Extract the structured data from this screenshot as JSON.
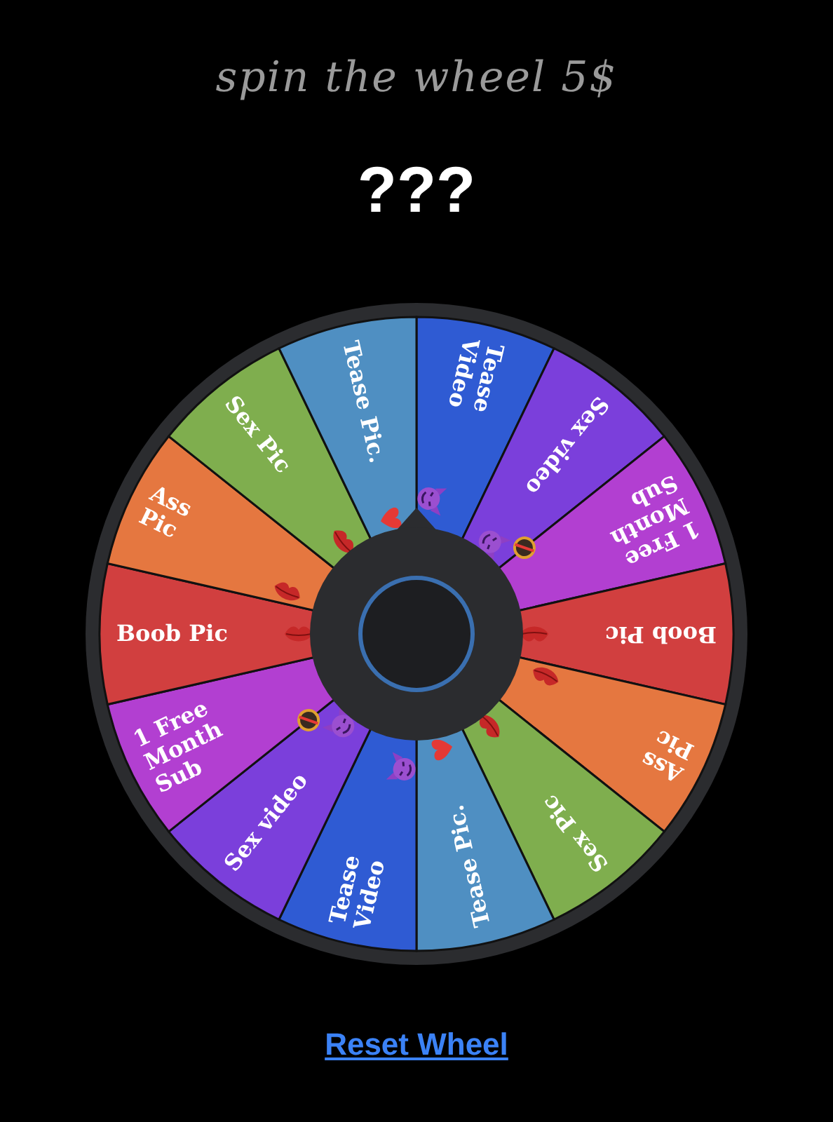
{
  "title": "spin the wheel 5$",
  "result": "???",
  "wheel": {
    "segments": [
      {
        "lines": [
          "Tease",
          "Video"
        ],
        "color": "#2f5bd3",
        "kind": "devil"
      },
      {
        "lines": [
          "Sex video"
        ],
        "color": "#7b3fdb",
        "kind": "devil"
      },
      {
        "lines": [
          "1 Free",
          "Month",
          "Sub"
        ],
        "color": "#b23fd1",
        "kind": "badge"
      },
      {
        "lines": [
          "Boob Pic"
        ],
        "color": "#d13f3f",
        "kind": "lips"
      },
      {
        "lines": [
          "Ass",
          "Pic"
        ],
        "color": "#e57740",
        "kind": "lips"
      },
      {
        "lines": [
          "Sex Pic"
        ],
        "color": "#7fae4e",
        "kind": "lips"
      },
      {
        "lines": [
          "Tease Pic."
        ],
        "color": "#4f8fc2",
        "kind": "heart"
      },
      {
        "lines": [
          "Tease",
          "Video"
        ],
        "color": "#2f5bd3",
        "kind": "devil"
      },
      {
        "lines": [
          "Sex video"
        ],
        "color": "#7b3fdb",
        "kind": "devil"
      },
      {
        "lines": [
          "1 Free",
          "Month",
          "Sub"
        ],
        "color": "#b23fd1",
        "kind": "badge"
      },
      {
        "lines": [
          "Boob Pic"
        ],
        "color": "#d13f3f",
        "kind": "lips"
      },
      {
        "lines": [
          "Ass",
          "Pic"
        ],
        "color": "#e57740",
        "kind": "lips"
      },
      {
        "lines": [
          "Sex Pic"
        ],
        "color": "#7fae4e",
        "kind": "lips"
      },
      {
        "lines": [
          "Tease Pic."
        ],
        "color": "#4f8fc2",
        "kind": "heart"
      }
    ]
  },
  "reset_link": "Reset Wheel"
}
